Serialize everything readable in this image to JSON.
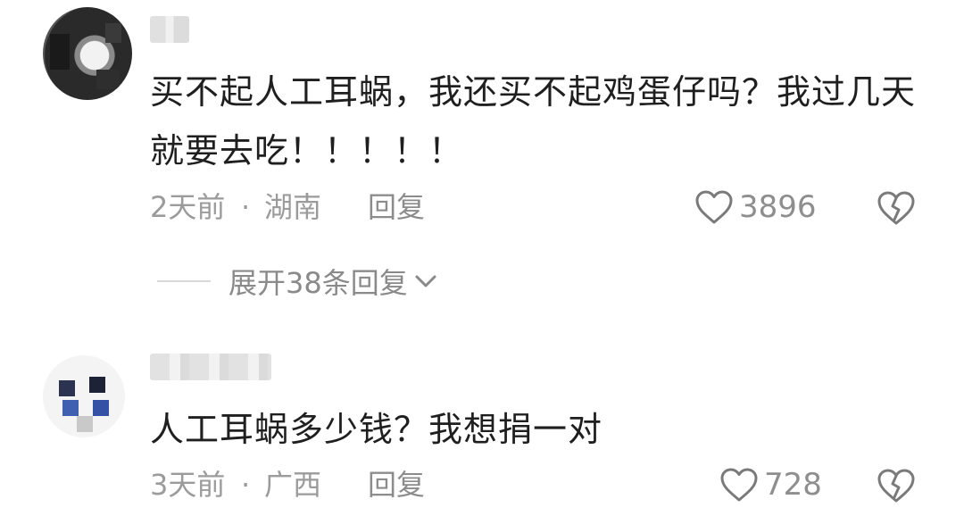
{
  "comments": [
    {
      "text": "买不起人工耳蜗，我还买不起鸡蛋仔吗？我过几天就要去吃！！！！！",
      "time": "2天前",
      "separator": "·",
      "location": "湖南",
      "reply_label": "回复",
      "likes": "3896",
      "expand_label": "展开38条回复",
      "icons": {
        "like": "heart-outline-icon",
        "dislike": "broken-heart-icon",
        "expand": "chevron-down-icon"
      }
    },
    {
      "text": "人工耳蜗多少钱？我想捐一对",
      "time": "3天前",
      "separator": "·",
      "location": "广西",
      "reply_label": "回复",
      "likes": "728",
      "icons": {
        "like": "heart-outline-icon",
        "dislike": "broken-heart-icon"
      }
    }
  ],
  "colors": {
    "text": "#1f1f1f",
    "meta": "#9b9b9b",
    "icon": "#7a7a7a",
    "background": "#ffffff"
  }
}
